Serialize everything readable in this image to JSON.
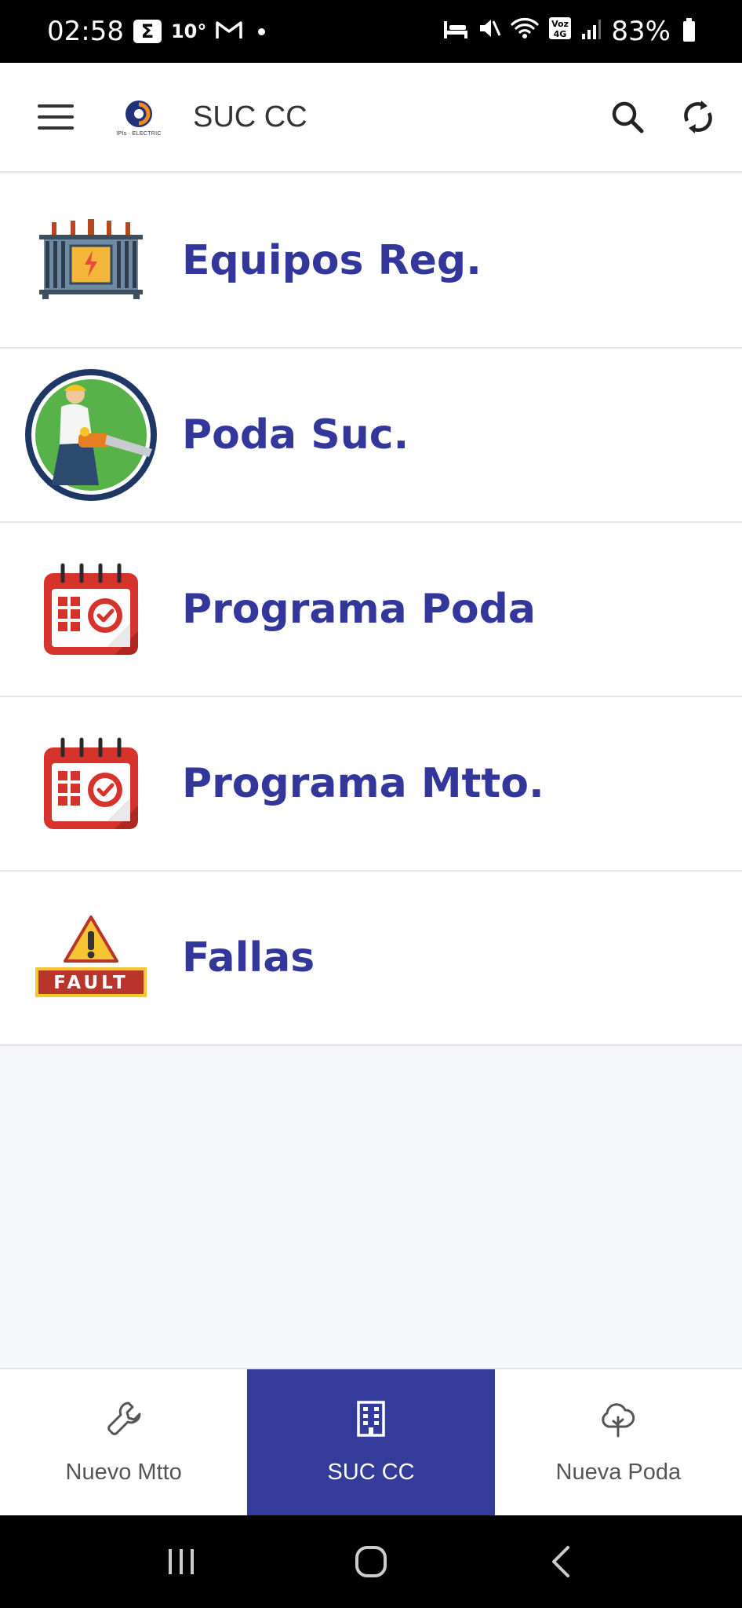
{
  "status_bar": {
    "time": "02:58",
    "sigma": "Σ",
    "temperature": "10°",
    "battery": "83%",
    "volte": "Voz 4G"
  },
  "app_bar": {
    "title": "SUC CC",
    "logo_text": "IPIs · ELECTRIC"
  },
  "menu": [
    {
      "label": "Equipos Reg.",
      "icon": "transformer-icon"
    },
    {
      "label": "Poda Suc.",
      "icon": "chainsaw-worker-icon"
    },
    {
      "label": "Programa Poda",
      "icon": "calendar-icon"
    },
    {
      "label": "Programa Mtto.",
      "icon": "calendar-icon"
    },
    {
      "label": "Fallas",
      "icon": "fault-warning-icon",
      "badge": "FAULT"
    }
  ],
  "bottom_nav": [
    {
      "label": "Nuevo Mtto",
      "icon": "wrench-icon",
      "active": false
    },
    {
      "label": "SUC CC",
      "icon": "building-icon",
      "active": true
    },
    {
      "label": "Nueva Poda",
      "icon": "tree-icon",
      "active": false
    }
  ],
  "colors": {
    "accent": "#333b9b",
    "label": "#33379b",
    "background": "#f6f7f9"
  }
}
